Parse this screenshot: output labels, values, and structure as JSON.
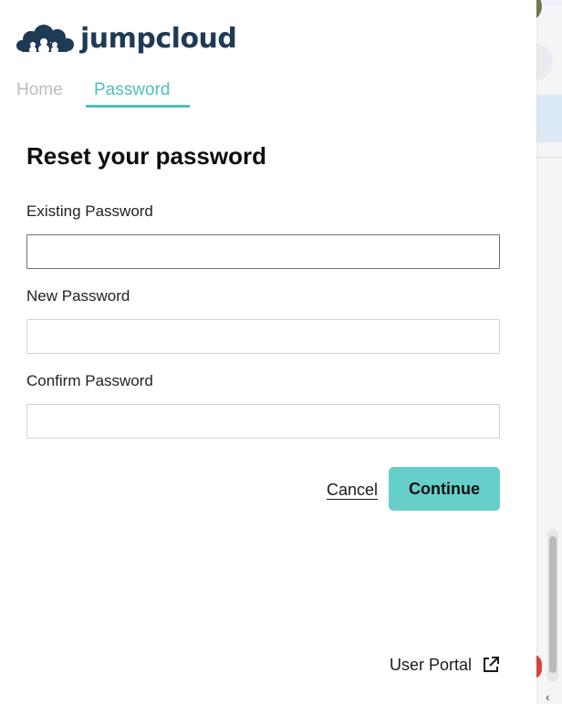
{
  "brand": {
    "name": "jumpcloud",
    "color": "#1f3a55",
    "icon": "cloud-logo-icon"
  },
  "tabs": [
    {
      "label": "Home",
      "active": false
    },
    {
      "label": "Password",
      "active": true
    }
  ],
  "accent_color": "#4fbfbb",
  "form": {
    "heading": "Reset your password",
    "fields": [
      {
        "label": "Existing Password",
        "value": "",
        "focused": true
      },
      {
        "label": "New Password",
        "value": ""
      },
      {
        "label": "Confirm Password",
        "value": ""
      }
    ],
    "cancel_label": "Cancel",
    "continue_label": "Continue",
    "continue_color": "#67cfca"
  },
  "footer": {
    "portal_label": "User Portal",
    "portal_icon": "external-link-icon"
  }
}
